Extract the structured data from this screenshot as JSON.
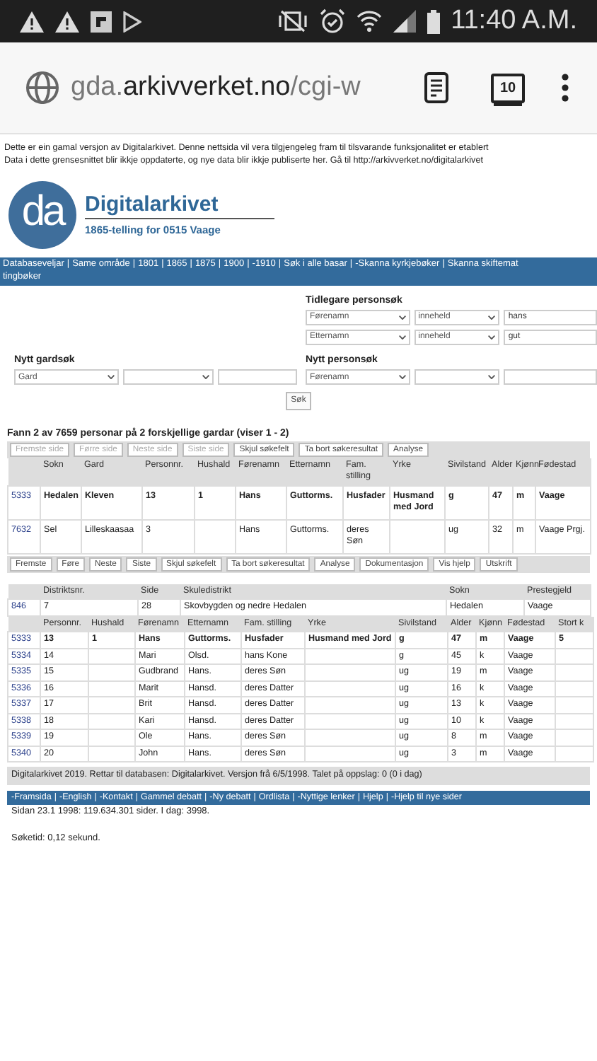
{
  "status_bar": {
    "time": "11:40 A.M."
  },
  "browser": {
    "url": "gda.arkivverket.no/cgi-w",
    "tab_count": "10"
  },
  "notice": [
    "Dette er ein gamal versjon av Digitalarkivet. Denne nettsida vil vera tilgjengeleg fram til tilsvarande funksjonalitet er etablert",
    "Data i dette grensesnittet blir ikkje oppdaterte, og nye data blir ikkje publiserte her. Gå til http://arkivverket.no/digitalarkivet"
  ],
  "header": {
    "logo_mark": "da",
    "title": "Digitalarkivet",
    "subtitle": "1865-telling for 0515 Vaage"
  },
  "nav": {
    "separator": "|",
    "lines": [
      [
        "Databaseveljar",
        "Same område",
        "1801",
        "1865",
        "1875",
        "1900",
        "-1910",
        "Søk i alle basar",
        "-Skanna kyrkjebøker",
        "Skanna skiftemat"
      ],
      [
        "tingbøker"
      ]
    ]
  },
  "previous_search": {
    "heading": "Tidlegare personsøk",
    "filters": [
      {
        "field": "Førenamn",
        "operator": "inneheld",
        "value": "hans"
      },
      {
        "field": "Etternamn",
        "operator": "inneheld",
        "value": "gut"
      }
    ]
  },
  "farm_search": {
    "heading": "Nytt gardsøk",
    "filters": [
      {
        "field": "Gard"
      }
    ]
  },
  "person_search": {
    "heading": "Nytt personsøk",
    "filters": [
      {
        "field": "Førenamn"
      }
    ]
  },
  "search_button": "Søk",
  "results_heading": "Fann 2 av 7659 personar på 2 forskjellige gardar (viser 1 - 2)",
  "pager_top": [
    {
      "label": "Fremste side",
      "disabled": true
    },
    {
      "label": "Førre side",
      "disabled": true
    },
    {
      "label": "Neste side",
      "disabled": true
    },
    {
      "label": "Siste side",
      "disabled": true
    },
    {
      "label": "Skjul søkefelt",
      "disabled": false
    },
    {
      "label": "Ta bort søkeresultat",
      "disabled": false
    },
    {
      "label": "Analyse",
      "disabled": false
    }
  ],
  "results_table": {
    "columns": [
      "Sokn",
      "Gard",
      "Personnr.",
      "Hushald",
      "Førenamn",
      "Etternamn",
      "Fam. stilling",
      "Yrke",
      "Sivilstand",
      "Alder",
      "Kjønn",
      "Fødestad"
    ],
    "rows": [
      {
        "id": "5333",
        "bold": true,
        "cells": [
          "Hedalen",
          "Kleven",
          "13",
          "1",
          "Hans",
          "Guttorms.",
          "Husfader",
          "Husmand med Jord",
          "g",
          "47",
          "m",
          "Vaage"
        ]
      },
      {
        "id": "7632",
        "bold": false,
        "cells": [
          "Sel",
          "Lilleskaasaa",
          "3",
          null,
          "Hans",
          "Guttorms.",
          "deres Søn",
          null,
          "ug",
          "32",
          "m",
          "Vaage Prgj."
        ]
      }
    ]
  },
  "pager_bottom": [
    {
      "label": "Fremste",
      "disabled": false
    },
    {
      "label": "Føre",
      "disabled": false
    },
    {
      "label": "Neste",
      "disabled": false
    },
    {
      "label": "Siste",
      "disabled": false
    },
    {
      "label": "Skjul søkefelt",
      "disabled": false
    },
    {
      "label": "Ta bort søkeresultat",
      "disabled": false
    },
    {
      "label": "Analyse",
      "disabled": false
    },
    {
      "label": "Dokumentasjon",
      "disabled": false
    },
    {
      "label": "Vis hjelp",
      "disabled": false
    },
    {
      "label": "Utskrift",
      "disabled": false
    }
  ],
  "district_table": {
    "columns": [
      "Distriktsnr.",
      "Side",
      "Skuledistrikt",
      "Sokn",
      "Prestegjeld"
    ],
    "rows": [
      {
        "id": "846",
        "bold": false,
        "cells": [
          "7",
          "28",
          "Skovbygden og nedre Hedalen",
          "Hedalen",
          "Vaage"
        ]
      }
    ]
  },
  "household_table": {
    "columns": [
      "Personnr.",
      "Hushald",
      "Førenamn",
      "Etternamn",
      "Fam. stilling",
      "Yrke",
      "Sivilstand",
      "Alder",
      "Kjønn",
      "Fødestad",
      "Stort k"
    ],
    "rows": [
      {
        "id": "5333",
        "bold": true,
        "cells": [
          "13",
          "1",
          "Hans",
          "Guttorms.",
          "Husfader",
          "Husmand med Jord",
          "g",
          "47",
          "m",
          "Vaage",
          "5"
        ]
      },
      {
        "id": "5334",
        "bold": false,
        "cells": [
          "14",
          null,
          "Mari",
          "Olsd.",
          "hans Kone",
          null,
          "g",
          "45",
          "k",
          "Vaage",
          null
        ]
      },
      {
        "id": "5335",
        "bold": false,
        "cells": [
          "15",
          null,
          "Gudbrand",
          "Hans.",
          "deres Søn",
          null,
          "ug",
          "19",
          "m",
          "Vaage",
          null
        ]
      },
      {
        "id": "5336",
        "bold": false,
        "cells": [
          "16",
          null,
          "Marit",
          "Hansd.",
          "deres Datter",
          null,
          "ug",
          "16",
          "k",
          "Vaage",
          null
        ]
      },
      {
        "id": "5337",
        "bold": false,
        "cells": [
          "17",
          null,
          "Brit",
          "Hansd.",
          "deres Datter",
          null,
          "ug",
          "13",
          "k",
          "Vaage",
          null
        ]
      },
      {
        "id": "5338",
        "bold": false,
        "cells": [
          "18",
          null,
          "Kari",
          "Hansd.",
          "deres Datter",
          null,
          "ug",
          "10",
          "k",
          "Vaage",
          null
        ]
      },
      {
        "id": "5339",
        "bold": false,
        "cells": [
          "19",
          null,
          "Ole",
          "Hans.",
          "deres Søn",
          null,
          "ug",
          "8",
          "m",
          "Vaage",
          null
        ]
      },
      {
        "id": "5340",
        "bold": false,
        "cells": [
          "20",
          null,
          "John",
          "Hans.",
          "deres Søn",
          null,
          "ug",
          "3",
          "m",
          "Vaage",
          null
        ]
      }
    ]
  },
  "footer": {
    "credits": "Digitalarkivet 2019. Rettar til databasen: Digitalarkivet. Versjon frå 6/5/1998. Talet på oppslag: 0 (0 i dag)",
    "links": [
      "-Framsida",
      "-English",
      "-Kontakt",
      "Gammel debatt",
      "-Ny debatt",
      "Ordlista",
      "-Nyttige lenker",
      "Hjelp",
      "-Hjelp til nye sider"
    ],
    "page_count": "Sidan 23.1 1998: 119.634.301 sider. I dag: 3998.",
    "search_time": "Søketid: 0,12 sekund."
  }
}
